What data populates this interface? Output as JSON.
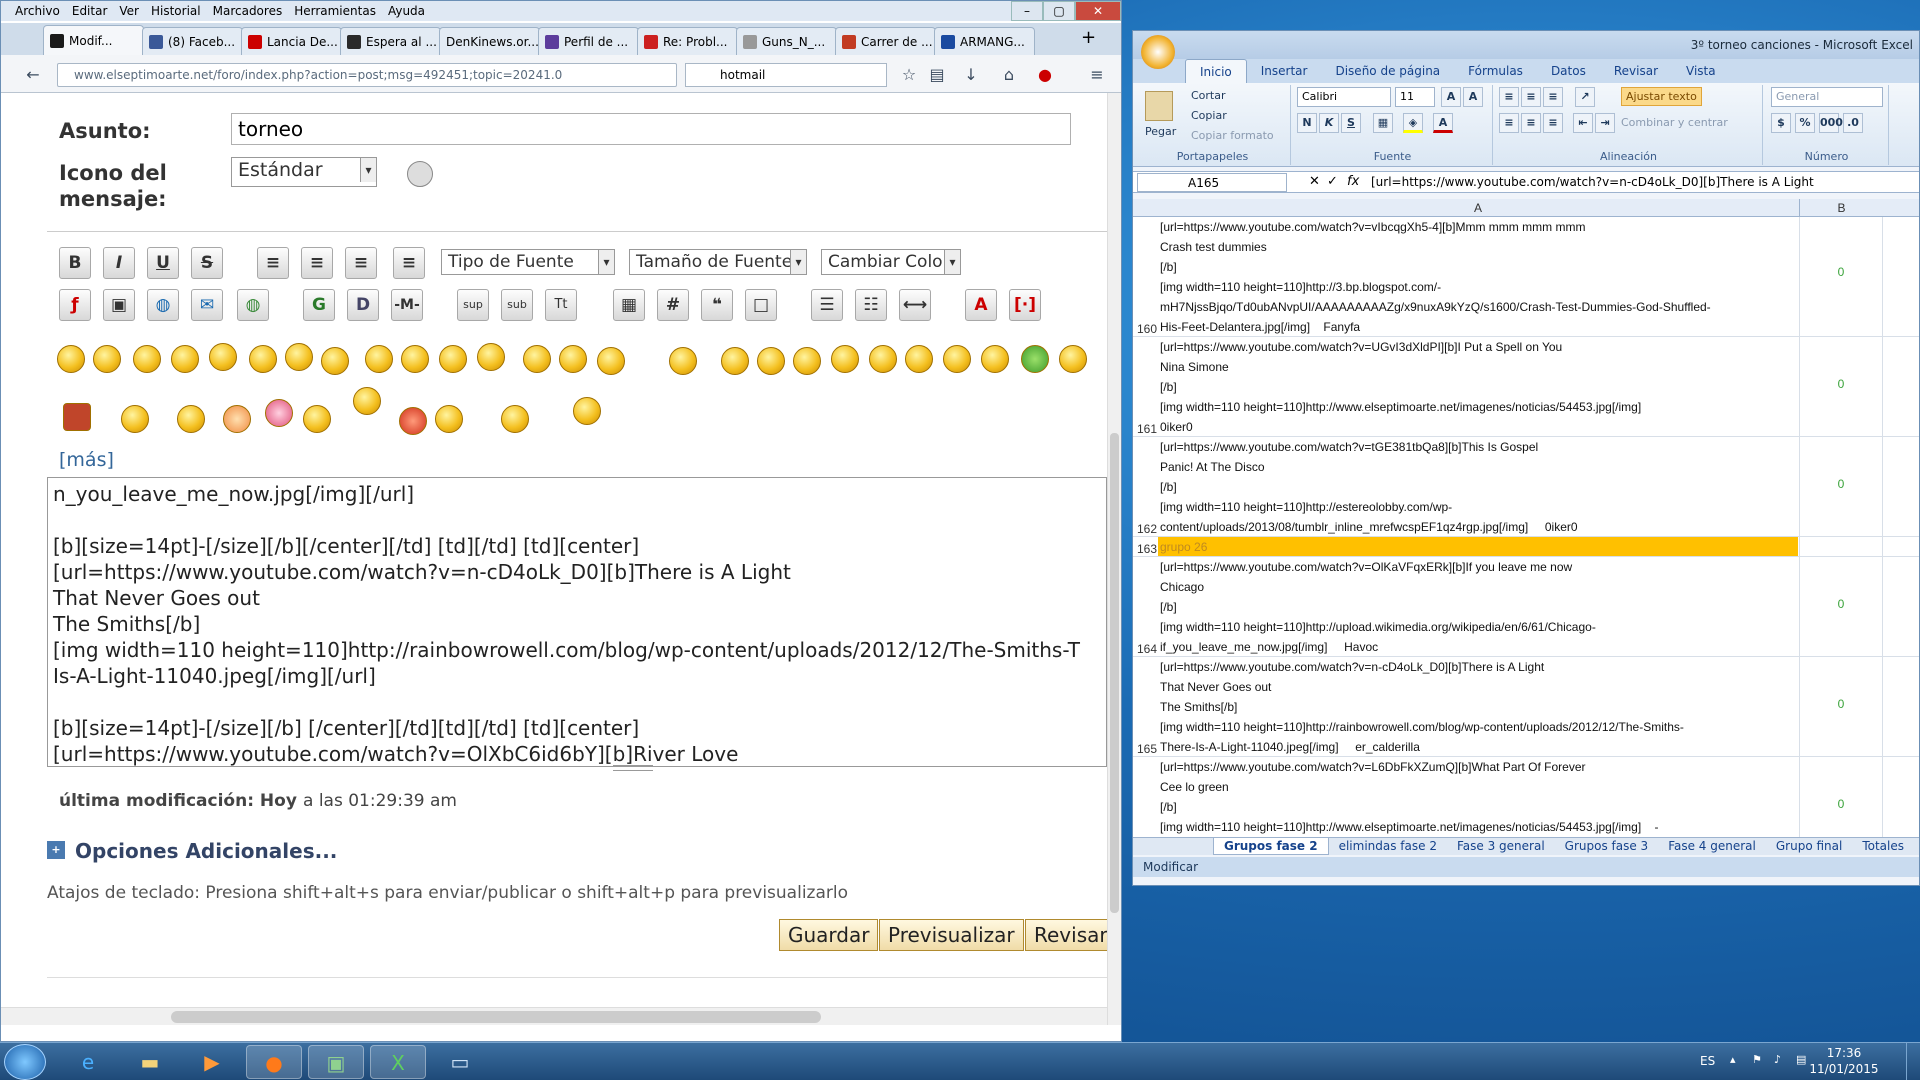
{
  "firefox": {
    "menu": [
      "Archivo",
      "Editar",
      "Ver",
      "Historial",
      "Marcadores",
      "Herramientas",
      "Ayuda"
    ],
    "tabs": [
      {
        "label": "Modif...",
        "color": "#1a1a1a"
      },
      {
        "label": "(8) Faceb...",
        "color": "#3b5998"
      },
      {
        "label": "Lancia De...",
        "color": "#cc0000"
      },
      {
        "label": "Espera al ...",
        "color": "#2a2a2a"
      },
      {
        "label": "DenKinews.or...",
        "color": "#ffffff"
      },
      {
        "label": "Perfil de ...",
        "color": "#5c3c9c"
      },
      {
        "label": "Re: Probl...",
        "color": "#cc2020"
      },
      {
        "label": "Guns_N_...",
        "color": "#888888"
      },
      {
        "label": "Carrer de ...",
        "color": "#c23b22"
      },
      {
        "label": "ARMANG...",
        "color": "#1a4aa0"
      }
    ],
    "url": "www.elseptimoarte.net/foro/index.php?action=post;msg=492451;topic=20241.0",
    "search": "hotmail",
    "form": {
      "subject_label": "Asunto:",
      "subject_value": "torneo",
      "icon_label_1": "Icono del",
      "icon_label_2": "mensaje:",
      "icon_value": "Estándar",
      "font_select": "Tipo de Fuente",
      "size_select": "Tamaño de Fuente",
      "color_select": "Cambiar Color",
      "more": "[más]",
      "editor_text": "n_you_leave_me_now.jpg[/img][/url]\n\n[b][size=14pt]-[/size][/b][/center][/td] [td][/td] [td][center]\n[url=https://www.youtube.com/watch?v=n-cD4oLk_D0][b]There is A Light\nThat Never Goes out\nThe Smiths[/b]\n[img width=110 height=110]http://rainbowrowell.com/blog/wp-content/uploads/2012/12/The-Smiths-T\nIs-A-Light-11040.jpeg[/img][/url]\n\n[b][size=14pt]-[/size][/b] [/center][/td][td][/td] [td][center]\n[url=https://www.youtube.com/watch?v=OlXbC6id6bY][b]River Love\nAngus Stone",
      "last_mod_label": "última modificación: Hoy",
      "last_mod_time": "a las 01:29:39 am",
      "options": "Opciones Adicionales...",
      "shortcuts": "Atajos de teclado: Presiona shift+alt+s para enviar/publicar o shift+alt+p para previsualizarlo",
      "save": "Guardar",
      "preview": "Previsualizar",
      "review": "Revisar"
    },
    "toolbar_row1": [
      "B",
      "I",
      "U",
      "S"
    ],
    "toolbar_row2": [
      "sup",
      "sub",
      "Tt",
      "#"
    ]
  },
  "excel": {
    "title": "3º torneo canciones - Microsoft Excel",
    "ribbon_tabs": [
      "Inicio",
      "Insertar",
      "Diseño de página",
      "Fórmulas",
      "Datos",
      "Revisar",
      "Vista"
    ],
    "groups": {
      "clipboard": "Portapapeles",
      "font": "Fuente",
      "alignment": "Alineación",
      "number": "Número"
    },
    "clipboard": {
      "paste": "Pegar",
      "cut": "Cortar",
      "copy": "Copiar",
      "format": "Copiar formato"
    },
    "font": {
      "name": "Calibri",
      "size": "11"
    },
    "align": {
      "wrap": "Ajustar texto",
      "merge": "Combinar y centrar"
    },
    "number": {
      "format": "General"
    },
    "namebox": "A165",
    "formula": "[url=https://www.youtube.com/watch?v=n-cD4oLk_D0][b]There is A Light",
    "col_a": "A",
    "col_b": "B",
    "rows": [
      {
        "n": "160",
        "a": "[url=https://www.youtube.com/watch?v=vIbcqgXh5-4][b]Mmm mmm mmm mmm\nCrash test dummies\n[/b]\n[img width=110 height=110]http://3.bp.blogspot.com/-\nmH7NjssBjqo/Td0ubANvpUI/AAAAAAAAAZg/x9nuxA9kYzQ/s1600/Crash-Test-Dummies-God-Shuffled-\nHis-Feet-Delantera.jpg[/img]    Fanyfa",
        "b": "0"
      },
      {
        "n": "161",
        "a": "[url=https://www.youtube.com/watch?v=UGvI3dXldPI][b]I Put a Spell on You\nNina Simone\n[/b]\n[img width=110 height=110]http://www.elseptimoarte.net/imagenes/noticias/54453.jpg[/img]\n0iker0",
        "b": "0"
      },
      {
        "n": "162",
        "a": "[url=https://www.youtube.com/watch?v=tGE381tbQa8][b]This Is Gospel\nPanic! At The Disco\n[/b]\n[img width=110 height=110]http://estereolobby.com/wp-\ncontent/uploads/2013/08/tumblr_inline_mrefwcspEF1qz4rgp.jpg[/img]     0iker0",
        "b": "0"
      },
      {
        "n": "163",
        "a": "grupo 26",
        "b": ""
      },
      {
        "n": "164",
        "a": "[url=https://www.youtube.com/watch?v=OlKaVFqxERk][b]If you leave me now\nChicago\n[/b]\n[img width=110 height=110]http://upload.wikimedia.org/wikipedia/en/6/61/Chicago-\nif_you_leave_me_now.jpg[/img]     Havoc",
        "b": "0"
      },
      {
        "n": "165",
        "a": "[url=https://www.youtube.com/watch?v=n-cD4oLk_D0][b]There is A Light\nThat Never Goes out\nThe Smiths[/b]\n[img width=110 height=110]http://rainbowrowell.com/blog/wp-content/uploads/2012/12/The-Smiths-\nThere-Is-A-Light-11040.jpeg[/img]     er_calderilla",
        "b": "0"
      },
      {
        "n": "166",
        "a": "[url=https://www.youtube.com/watch?v=L6DbFkXZumQ][b]What Part Of Forever\nCee lo green\n[/b]\n[img width=110 height=110]http://www.elseptimoarte.net/imagenes/noticias/54453.jpg[/img]    -",
        "b": "0"
      }
    ],
    "sheets": [
      "Grupos fase 2",
      "elimindas fase 2",
      "Fase 3 general",
      "Grupos fase 3",
      "Fase 4 general",
      "Grupo final",
      "Totales"
    ],
    "status": "Modificar",
    "highlight_color": "#ffc000"
  },
  "taskbar": {
    "lang": "ES",
    "time": "17:36",
    "date": "11/01/2015"
  }
}
